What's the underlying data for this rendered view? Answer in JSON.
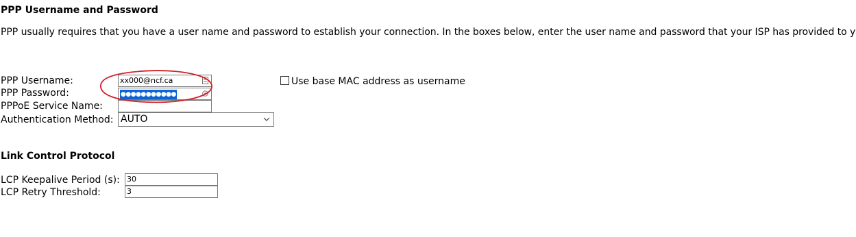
{
  "ppp_section": {
    "heading": "PPP Username and Password",
    "description": "PPP usually requires that you have a user name and password to establish your connection. In the boxes below, enter the user name and password that your ISP has provided to you.",
    "username_label": "PPP Username:",
    "username_value": "xx000@ncf.ca",
    "password_label": "PPP Password:",
    "password_mask": "●●●●●●●●●●●",
    "service_name_label": "PPPoE Service Name:",
    "service_name_value": "",
    "auth_label": "Authentication Method:",
    "auth_selected": "AUTO",
    "mac_checkbox_label": "Use base MAC address as username",
    "mac_checkbox_checked": false
  },
  "lcp_section": {
    "heading": "Link Control Protocol",
    "keepalive_label": "LCP Keepalive Period (s):",
    "keepalive_value": "30",
    "retry_label": "LCP Retry Threshold:",
    "retry_value": "3"
  },
  "icons": {
    "username_field_icon": "contact-card-icon",
    "password_field_icon": "reveal-password-icon",
    "auth_dropdown_icon": "chevron-down-icon"
  },
  "colors": {
    "annotation_ellipse": "#d4202a",
    "selection_highlight": "#0a64d6"
  }
}
